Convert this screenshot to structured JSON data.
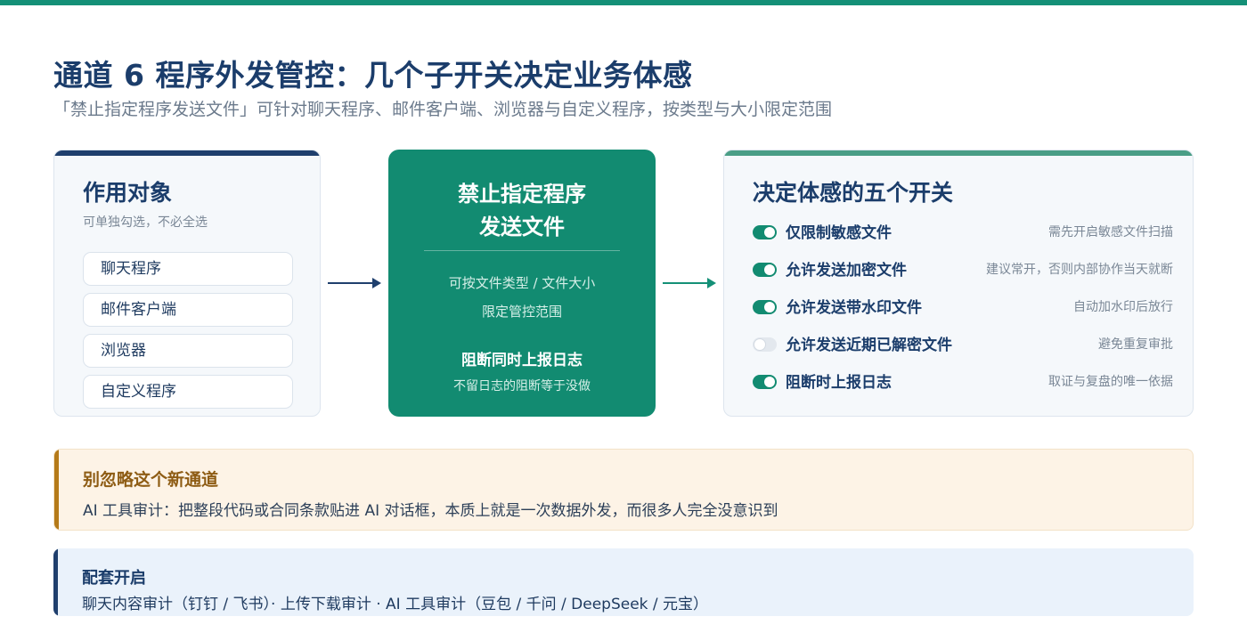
{
  "header": {
    "title": "通道 6 程序外发管控：几个子开关决定业务体感",
    "subtitle": "「禁止指定程序发送文件」可针对聊天程序、邮件客户端、浏览器与自定义程序，按类型与大小限定范围"
  },
  "targets": {
    "title": "作用对象",
    "hint": "可单独勾选，不必全选",
    "items": [
      "聊天程序",
      "邮件客户端",
      "浏览器",
      "自定义程序"
    ]
  },
  "policy": {
    "title_line1": "禁止指定程序",
    "title_line2": "发送文件",
    "scope_line1": "可按文件类型 / 文件大小",
    "scope_line2": "限定管控范围",
    "log_title": "阻断同时上报日志",
    "log_note": "不留日志的阻断等于没做"
  },
  "switches": {
    "title": "决定体感的五个开关",
    "items": [
      {
        "label": "仅限制敏感文件",
        "desc": "需先开启敏感文件扫描",
        "on": true
      },
      {
        "label": "允许发送加密文件",
        "desc": "建议常开，否则内部协作当天就断",
        "on": true
      },
      {
        "label": "允许发送带水印文件",
        "desc": "自动加水印后放行",
        "on": true
      },
      {
        "label": "允许发送近期已解密文件",
        "desc": "避免重复审批",
        "on": false
      },
      {
        "label": "阻断时上报日志",
        "desc": "取证与复盘的唯一依据",
        "on": true
      }
    ]
  },
  "warning": {
    "title": "别忽略这个新通道",
    "text": "AI 工具审计：把整段代码或合同条款贴进 AI 对话框，本质上就是一次数据外发，而很多人完全没意识到"
  },
  "companion": {
    "title": "配套开启",
    "text": "聊天内容审计（钉钉 / 飞书）· 上传下载审计 · AI 工具审计（豆包 / 千问 / DeepSeek / 元宝）"
  },
  "colors": {
    "primary_navy": "#1b3d6b",
    "accent_green": "#128b71",
    "warning_amber": "#b57a18",
    "warning_bg": "#fdf3e6",
    "info_bg": "#eaf2fb"
  }
}
